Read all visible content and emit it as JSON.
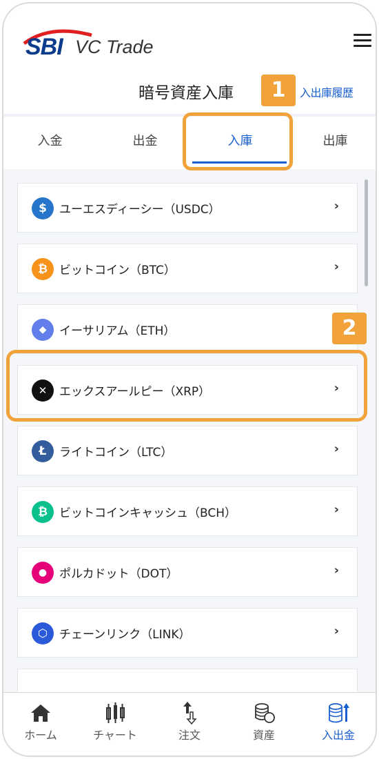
{
  "header": {
    "logo_sbi": "SBI",
    "logo_vc": "VC Trade",
    "page_title": "暗号資産入庫",
    "history_link": "入出庫履歴"
  },
  "annotations": {
    "badge_1": "1",
    "badge_2": "2"
  },
  "tabs": [
    {
      "label": "入金",
      "active": false
    },
    {
      "label": "出金",
      "active": false
    },
    {
      "label": "入庫",
      "active": true
    },
    {
      "label": "出庫",
      "active": false
    }
  ],
  "coins": [
    {
      "name": "ユーエスディーシー（USDC）",
      "icon": "usdc-icon",
      "symbol": "$",
      "color": "#2775ca"
    },
    {
      "name": "ビットコイン（BTC）",
      "icon": "bitcoin-icon",
      "symbol": "₿",
      "color": "#f7931a"
    },
    {
      "name": "イーサリアム（ETH）",
      "icon": "ethereum-icon",
      "symbol": "◆",
      "color": "#627eea"
    },
    {
      "name": "エックスアールピー（XRP）",
      "icon": "xrp-icon",
      "symbol": "✕",
      "color": "#111111"
    },
    {
      "name": "ライトコイン（LTC）",
      "icon": "litecoin-icon",
      "symbol": "Ł",
      "color": "#345d9d"
    },
    {
      "name": "ビットコインキャッシュ（BCH）",
      "icon": "bitcoin-cash-icon",
      "symbol": "₿",
      "color": "#0ac18e"
    },
    {
      "name": "ポルカドット（DOT）",
      "icon": "polkadot-icon",
      "symbol": "●",
      "color": "#e6007a"
    },
    {
      "name": "チェーンリンク（LINK）",
      "icon": "chainlink-icon",
      "symbol": "⬡",
      "color": "#2a5ada"
    }
  ],
  "bottom_nav": [
    {
      "label": "ホーム",
      "icon": "home-icon",
      "active": false
    },
    {
      "label": "チャート",
      "icon": "chart-icon",
      "active": false
    },
    {
      "label": "注文",
      "icon": "order-icon",
      "active": false
    },
    {
      "label": "資産",
      "icon": "assets-icon",
      "active": false
    },
    {
      "label": "入出金",
      "icon": "deposit-withdraw-icon",
      "active": true
    }
  ]
}
